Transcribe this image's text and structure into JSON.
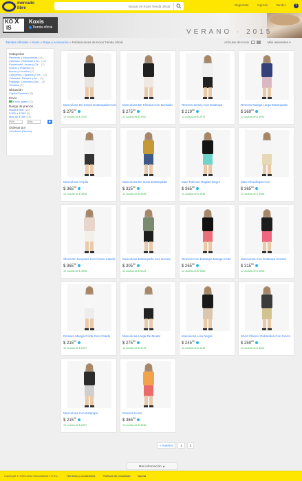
{
  "header": {
    "logo_line1": "mercado",
    "logo_line2": "libre",
    "search_placeholder": "Buscar en Koxis Tienda oficial",
    "nav": [
      "Registrate",
      "Ingresá",
      "Vender"
    ],
    "help_label": "?",
    "accent": "#ffe600",
    "brand": "#2d3277"
  },
  "store": {
    "logo_top": "KO",
    "logo_mark": "X",
    "logo_bottom": "IS",
    "name": "Koxis",
    "badge": "Tienda oficial",
    "banner_title": "VERANO · 2015"
  },
  "breadcrumb": {
    "root": "Tiendas oficiales",
    "items": [
      "Koxis",
      "Ropa y Accesorios"
    ],
    "current": "Publicaciones de Koxis Tienda oficial"
  },
  "sort": {
    "label": "Artículos de",
    "value": "Koxis",
    "order": "Más relevantes"
  },
  "filters": {
    "categories_title": "Categorías",
    "categories": [
      {
        "label": "Remeras y Musculosas",
        "count": "(14)"
      },
      {
        "label": "Camisas, Chombas y Bl...",
        "count": "(12)"
      },
      {
        "label": "Pantalones, Jeans y Ca...",
        "count": "(7)"
      },
      {
        "label": "Shorts y Polleras",
        "count": "(5)"
      },
      {
        "label": "Buzos y Hoodies",
        "count": "(4)"
      },
      {
        "label": "Camperas, Tapados y Tre...",
        "count": "(4)"
      },
      {
        "label": "Calzados, Relojes y Ac...",
        "count": "(3)"
      },
      {
        "label": "Equipaje, Carteras y Bol...",
        "count": "(3)"
      },
      {
        "label": "Vestidos",
        "count": "(2)"
      }
    ],
    "location_title": "Ubicación",
    "location": "Capital Federal",
    "location_count": "(45)",
    "shipping_title": "Envío",
    "shipping": "Envío gratis",
    "shipping_count": "(21)",
    "price_title": "Rango de precios",
    "prices": [
      {
        "label": "Hasta $ 300",
        "count": "(18)"
      },
      {
        "label": "$ 300 a $ 350",
        "count": "(9)"
      },
      {
        "label": "Más de $ 350",
        "count": "(18)"
      }
    ],
    "min_placeholder": "Mín",
    "max_placeholder": "Máx",
    "sort_title": "Ordenar por",
    "sort_option": "Condición (Nuevo)"
  },
  "products": [
    {
      "title": "Musculosa De Crepe Estampada Koxis",
      "price": "$ 275",
      "cents": "00",
      "installments": "12 cuotas de $ 3700"
    },
    {
      "title": "Musculosa De Fibrana Con Bordado",
      "price": "$ 275",
      "cents": "00",
      "installments": "12 cuotas de $ 3700"
    },
    {
      "title": "Remera Jersey Con Estampa",
      "price": "$ 219",
      "cents": "00",
      "installments": "12 cuotas de $ 2979"
    },
    {
      "title": "Remera Manga Larga Estampada",
      "price": "$ 369",
      "cents": "00",
      "installments": "12 cuotas de $ 4991"
    },
    {
      "title": "Musculosa Amplia",
      "price": "$ 365",
      "cents": "00",
      "installments": "12 cuotas de $ 4936"
    },
    {
      "title": "Musculosa De Gasa Estampada",
      "price": "$ 325",
      "cents": "00",
      "installments": "12 cuotas de $ 4395"
    },
    {
      "title": "Maxi Pullover Raglan Negro",
      "price": "$ 365",
      "cents": "00",
      "installments": "12 cuotas de $ 4936"
    },
    {
      "title": "Maxi Chanillopa Koxi",
      "price": "$ 365",
      "cents": "00",
      "installments": "12 cuotas de $ 4936"
    },
    {
      "title": "Short De Jacquard Con Cierre Lateral",
      "price": "$ 365",
      "cents": "00",
      "installments": "12 cuotas de $ 4936"
    },
    {
      "title": "Musculosa Estampada Con Escote",
      "price": "$ 305",
      "cents": "00",
      "installments": "12 cuotas de $ 4125"
    },
    {
      "title": "Remera Con Estampa Manga Corta",
      "price": "$ 265",
      "cents": "00",
      "installments": "12 cuotas de $ 3584"
    },
    {
      "title": "Musculosa Con Estampa Central",
      "price": "$ 315",
      "cents": "00",
      "installments": "12 cuotas de $ 4260"
    },
    {
      "title": "Remera Manga Corta Con Calado",
      "price": "$ 215",
      "cents": "00",
      "installments": "12 cuotas de $ 2907"
    },
    {
      "title": "Musculosa Larga De Modal",
      "price": "$ 275",
      "cents": "00",
      "installments": "12 cuotas de $ 3719"
    },
    {
      "title": "Musculosa Lisa Negra",
      "price": "$ 245",
      "cents": "00",
      "installments": "12 cuotas de $ 3313"
    },
    {
      "title": "Short Clásico Gabardina Con Cierre",
      "price": "$ 259",
      "cents": "00",
      "installments": "12 cuotas de $ 3502"
    },
    {
      "title": "Musculosa Con Estampa",
      "price": "$ 215",
      "cents": "00",
      "installments": "12 cuotas de $ 2907"
    },
    {
      "title": "Remera Koxis",
      "price": "$ 365",
      "cents": "00",
      "installments": "12 cuotas de $ 4936"
    }
  ],
  "pagination": {
    "prev": "« Anterior",
    "pages": [
      "1",
      "2"
    ]
  },
  "more_info": "Más información ▲",
  "footer": {
    "copyright": "Copyright © 1999-2014 MercadoLibre S.R.L.",
    "links": [
      "Términos y condiciones",
      "Políticas de privacidad",
      "Ayuda"
    ]
  }
}
